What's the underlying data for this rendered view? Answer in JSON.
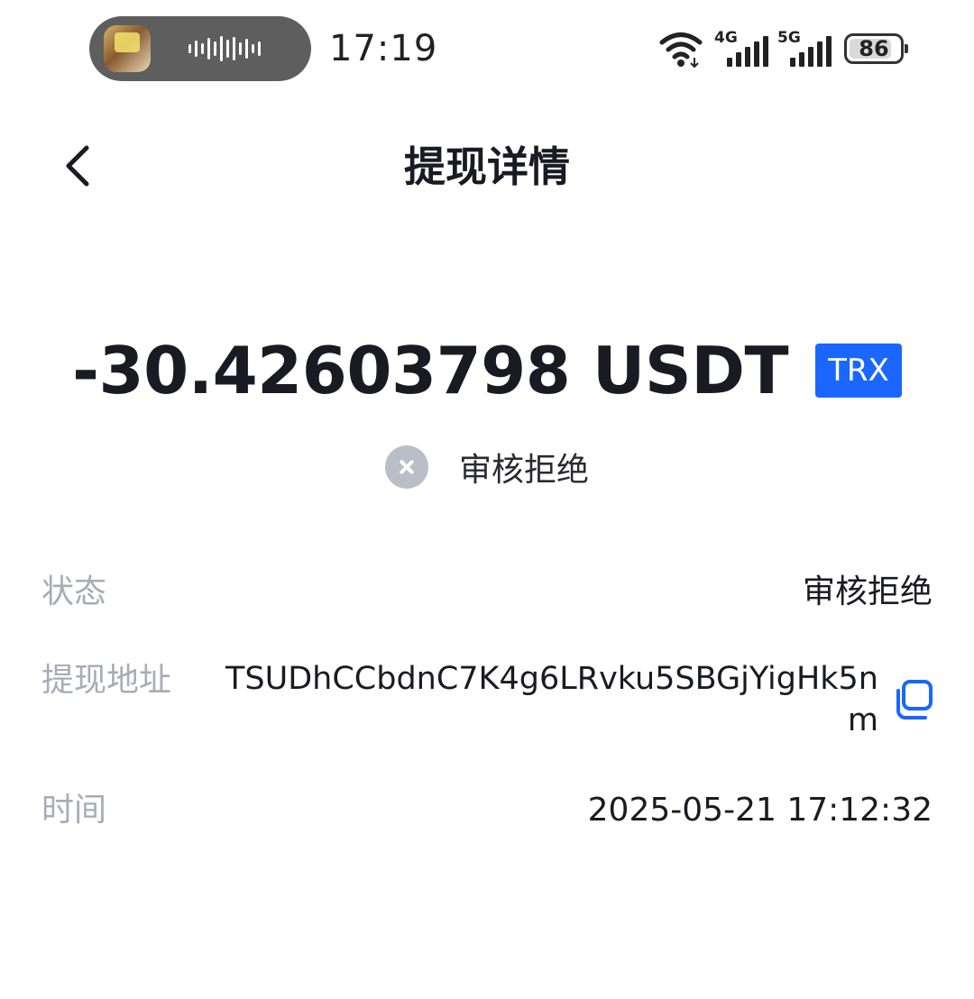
{
  "status_bar": {
    "time": "17:19",
    "network_1": "4G",
    "network_2": "5G",
    "battery": "86",
    "battery_level": 0.86
  },
  "header": {
    "title": "提现详情"
  },
  "summary": {
    "amount": "-30.42603798 USDT",
    "network": "TRX",
    "status": "审核拒绝"
  },
  "details": {
    "status_label": "状态",
    "status_value": "审核拒绝",
    "address_label": "提现地址",
    "address_value": "TSUDhCCbdnC7K4g6LRvku5SBGjYigHk5nm",
    "time_label": "时间",
    "time_value": "2025-05-21 17:12:32"
  },
  "colors": {
    "accent": "#1a66ff",
    "muted_label": "#a7acb5",
    "status_icon": "#b9bec7"
  }
}
